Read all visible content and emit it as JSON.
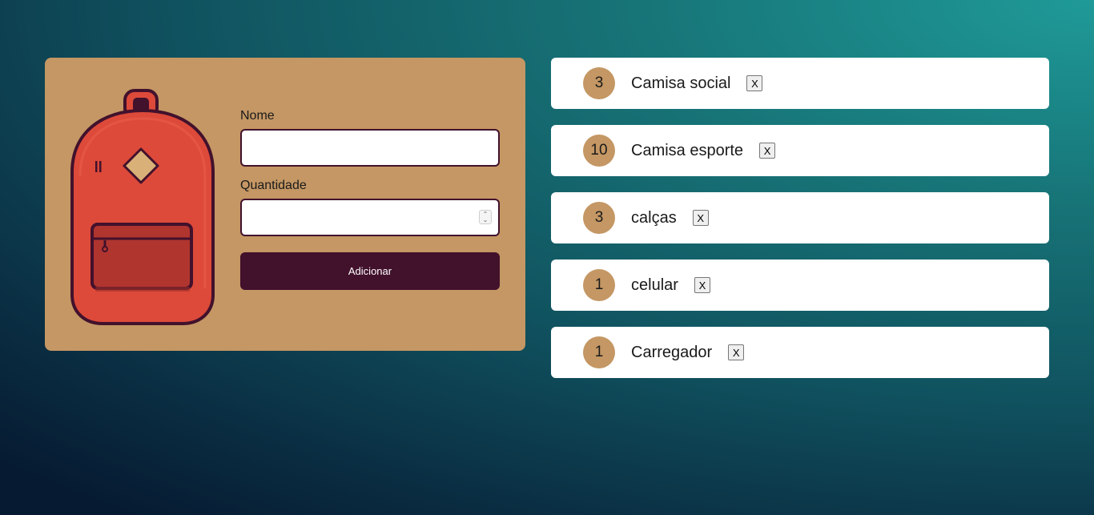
{
  "form": {
    "name_label": "Nome",
    "name_value": "",
    "quantity_label": "Quantidade",
    "quantity_value": "",
    "submit_label": "Adicionar"
  },
  "items": [
    {
      "quantity": "3",
      "name": "Camisa social",
      "remove_label": "X"
    },
    {
      "quantity": "10",
      "name": "Camisa esporte",
      "remove_label": "X"
    },
    {
      "quantity": "3",
      "name": "calças",
      "remove_label": "X"
    },
    {
      "quantity": "1",
      "name": "celular",
      "remove_label": "X"
    },
    {
      "quantity": "1",
      "name": "Carregador",
      "remove_label": "X"
    }
  ],
  "icons": {
    "illustration": "backpack-icon",
    "spinner": "spinner-arrows-icon"
  },
  "colors": {
    "card": "#c49764",
    "accent": "#42112c",
    "backpack_body": "#dd4a3a",
    "backpack_pocket": "#b0352f",
    "item_bg": "#ffffff"
  }
}
